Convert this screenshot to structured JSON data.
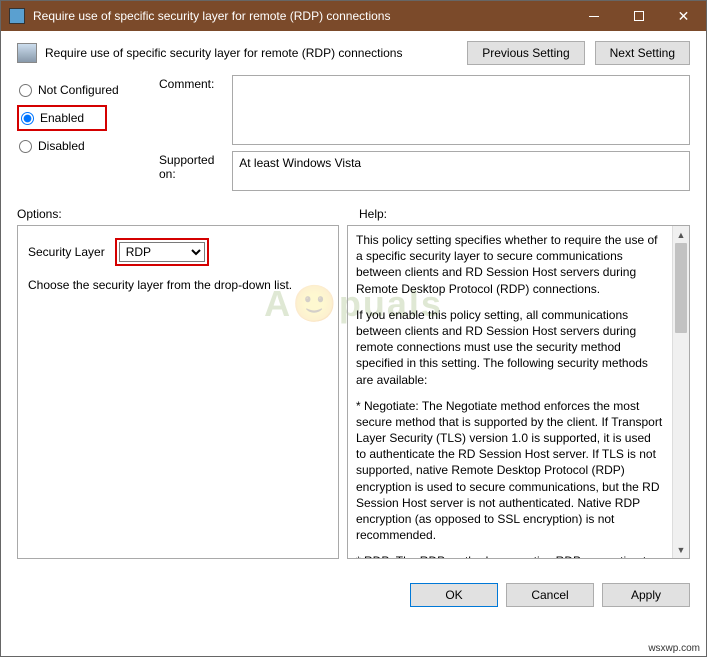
{
  "title": "Require use of specific security layer for remote (RDP) connections",
  "header_text": "Require use of specific security layer for remote (RDP) connections",
  "nav": {
    "prev": "Previous Setting",
    "next": "Next Setting"
  },
  "state": {
    "not_configured": "Not Configured",
    "enabled": "Enabled",
    "disabled": "Disabled",
    "selected": "enabled"
  },
  "labels": {
    "comment": "Comment:",
    "supported": "Supported on:",
    "options": "Options:",
    "help": "Help:"
  },
  "comment_value": "",
  "supported_value": "At least Windows Vista",
  "options": {
    "security_layer_label": "Security Layer",
    "security_layer_value": "RDP",
    "security_layer_choices": [
      "RDP"
    ],
    "description": "Choose the security layer from the drop-down list."
  },
  "help_paragraphs": [
    "This policy setting specifies whether to require the use of a specific security layer to secure communications between clients and RD Session Host servers during Remote Desktop Protocol (RDP) connections.",
    "If you enable this policy setting, all communications between clients and RD Session Host servers during remote connections must use the security method specified in this setting. The following security methods are available:",
    "* Negotiate: The Negotiate method enforces the most secure method that is supported by the client. If Transport Layer Security (TLS) version 1.0 is supported, it is used to authenticate the RD Session Host server. If TLS is not supported, native Remote Desktop Protocol (RDP) encryption is used to secure communications, but the RD Session Host server is not authenticated. Native RDP encryption (as opposed to SSL encryption) is not recommended.",
    "* RDP: The RDP method uses native RDP encryption to secure communications between the client and RD Session Host server."
  ],
  "buttons": {
    "ok": "OK",
    "cancel": "Cancel",
    "apply": "Apply"
  },
  "watermark": "A🙂puals",
  "source_tag": "wsxwp.com"
}
